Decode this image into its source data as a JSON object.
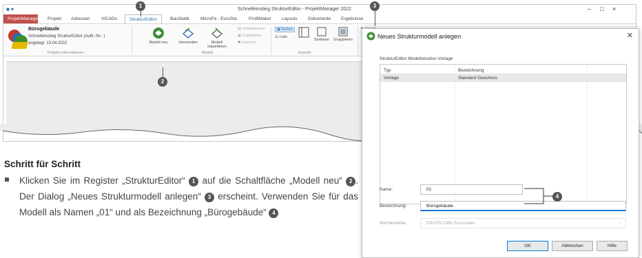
{
  "app": {
    "title": "Schnelleinstieg StrukturEditor - ProjektManager 2022",
    "window_controls": [
      "–",
      "□",
      "×"
    ]
  },
  "tabs": [
    "ProjektManager",
    "Projekt",
    "Adressen",
    "ViCADo",
    "StrukturEditor",
    "BauStatik",
    "MicroFe - EuroSta",
    "ProfilMaker",
    "Layouts",
    "Dokumente",
    "Ergebnisse"
  ],
  "project": {
    "name": "Bürogebäude",
    "line1": "Schnelleinstieg StrukturEditor (Auftr.-Nr.: )",
    "line2": "angelegt: 13.04.2022",
    "group_label": "Projekt-Informationen"
  },
  "ribbon": {
    "modell_neu": "Modell neu",
    "verwenden": "Verwenden",
    "modell_importieren": "Modell importieren",
    "umbenennen": "Umbenennen",
    "duplizieren": "Duplizieren",
    "loeschen": "Löschen",
    "group_modell": "Modell",
    "karten": "Karten",
    "liste": "Liste",
    "sortieren": "Sortieren",
    "gruppieren": "Gruppieren",
    "group_ansicht": "Ansicht",
    "zusatz": "Zusatz",
    "group_ve": "Ve"
  },
  "callouts": [
    "1",
    "2",
    "3",
    "4"
  ],
  "instructions": {
    "title": "Schritt für Schritt",
    "p1": "Klicken Sie im Register „StrukturEditor“",
    "p2": "auf die Schaltfläche „Modell neu“",
    "p3": ". Der Dialog „Neues Strukturmodell anlegen“",
    "p4": "erscheint. Verwenden Sie für das Modell als Namen „01“ und als Bezeichnung „Bürogebäude“"
  },
  "dialog": {
    "title": "Neues Strukturmodell anlegen",
    "caption": "StrukturEditor Modellstruktur-Vorlage",
    "rows": [
      {
        "col1": "Typ",
        "col2": "Bezeichnung"
      },
      {
        "col1": "Vorlage",
        "col2": "Standard Geschoss"
      }
    ],
    "name_label": "Name:",
    "name_value": "01",
    "bez_label": "Bezeichnung:",
    "bez_value": "Bürogebäude",
    "norm_label": "Normenreihe:",
    "norm_value": "DIN EN 199x Eurocodes",
    "ok": "OK",
    "cancel": "Abbrechen",
    "help": "Hilfe"
  },
  "colors": {
    "accent": "#0078d7",
    "brand": "#c0504d",
    "callout": "#555555"
  }
}
